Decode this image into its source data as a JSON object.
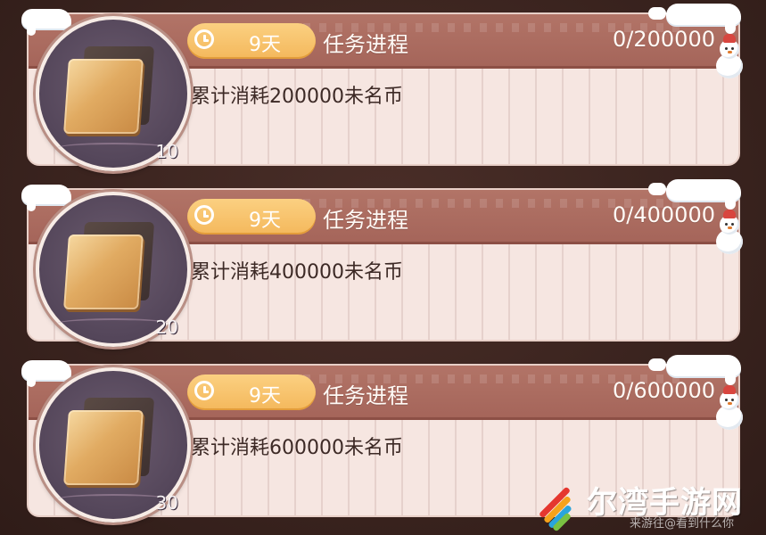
{
  "tasks": [
    {
      "timer": "9天",
      "label": "任务进程",
      "progress": "0/200000",
      "description": "累计消耗200000未名币",
      "count": "10"
    },
    {
      "timer": "9天",
      "label": "任务进程",
      "progress": "0/400000",
      "description": "累计消耗400000未名币",
      "count": "20"
    },
    {
      "timer": "9天",
      "label": "任务进程",
      "progress": "0/600000",
      "description": "累计消耗600000未名币",
      "count": "30"
    }
  ],
  "watermark": {
    "brand": "尔湾手游网",
    "sub": "来游往@看到什么你"
  },
  "colors": {
    "header": "#a5655a",
    "timer_pill": "#f4b85c",
    "card_body": "#f6e6e1",
    "frame": "#54465a"
  },
  "icons": [
    "clock-icon",
    "wood-plank-icon",
    "snowman-icon"
  ]
}
